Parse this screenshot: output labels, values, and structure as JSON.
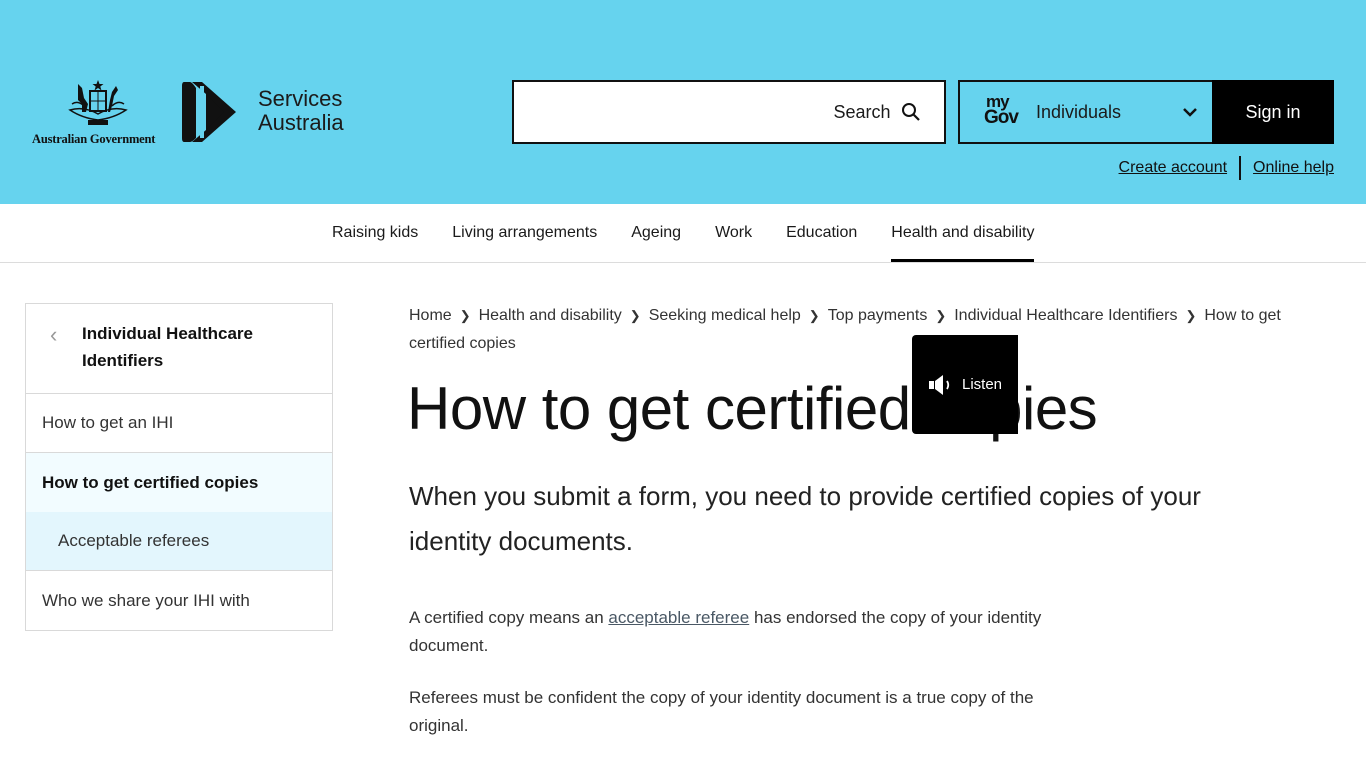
{
  "header": {
    "gov_logo_text": "Australian Government",
    "agency_name_line1": "Services",
    "agency_name_line2": "Australia",
    "search": {
      "value": "",
      "placeholder": "",
      "button_label": "Search"
    },
    "mygov": {
      "logo_line1": "my",
      "logo_line2": "Gov",
      "selected_audience": "Individuals",
      "sign_in_label": "Sign in"
    },
    "links": [
      {
        "label": "Create account"
      },
      {
        "label": "Online help"
      }
    ],
    "brand_color": "#66d3ee"
  },
  "main_nav": {
    "items": [
      {
        "label": "Raising kids"
      },
      {
        "label": "Living arrangements"
      },
      {
        "label": "Ageing"
      },
      {
        "label": "Work"
      },
      {
        "label": "Education"
      },
      {
        "label": "Health and disability",
        "active": true
      }
    ]
  },
  "side_nav": {
    "title": "Individual Healthcare Identifiers",
    "items": [
      {
        "label": "How to get an IHI"
      },
      {
        "label": "How to get certified copies",
        "current": true
      },
      {
        "label": "Acceptable referees"
      },
      {
        "label": "Who we share your IHI with"
      }
    ]
  },
  "breadcrumb": [
    {
      "label": "Home"
    },
    {
      "label": "Health and disability"
    },
    {
      "label": "Seeking medical help"
    },
    {
      "label": "Top payments"
    },
    {
      "label": "Individual Healthcare Identifiers"
    },
    {
      "label": "How to get certified copies"
    }
  ],
  "content": {
    "title": "How to get certified copies",
    "lead": "When you submit a form, you need to provide certified copies of your identity documents.",
    "p1_before": "A certified copy means an ",
    "p1_link": "acceptable referee",
    "p1_after": " has endorsed the copy of your identity document.",
    "p2": "Referees must be confident the copy of your identity document is a true copy of the original."
  },
  "listen_button": {
    "label": "Listen"
  }
}
